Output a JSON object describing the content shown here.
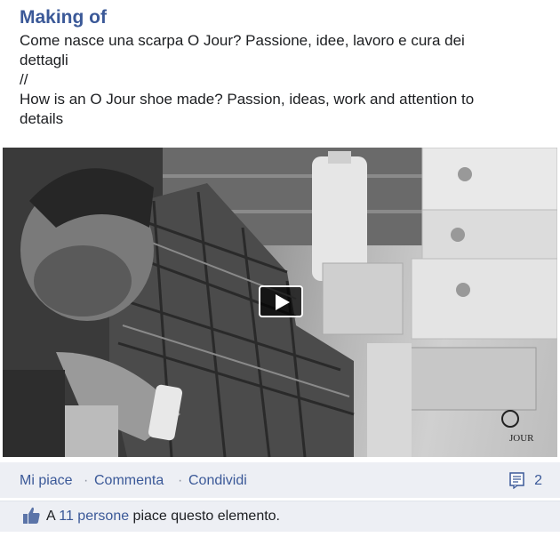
{
  "post": {
    "title": "Making of",
    "description_lines": [
      "Come nasce una scarpa O Jour? Passione, idee, lavoro e cura dei",
      "dettagli",
      "//",
      "How is an O Jour shoe made? Passion, ideas, work and attention to",
      "details"
    ]
  },
  "video": {
    "play_icon": "play-icon",
    "watermark": "JOUR"
  },
  "actions": {
    "like": "Mi piace",
    "comment": "Commenta",
    "share": "Condividi",
    "separator": "·",
    "comment_count": "2",
    "comment_icon": "comment-icon"
  },
  "likes": {
    "prefix": "A ",
    "people": "11 persone",
    "suffix": " piace questo elemento.",
    "icon": "thumbs-up-icon"
  },
  "colors": {
    "link": "#3b5998",
    "bar": "#edeff4"
  }
}
